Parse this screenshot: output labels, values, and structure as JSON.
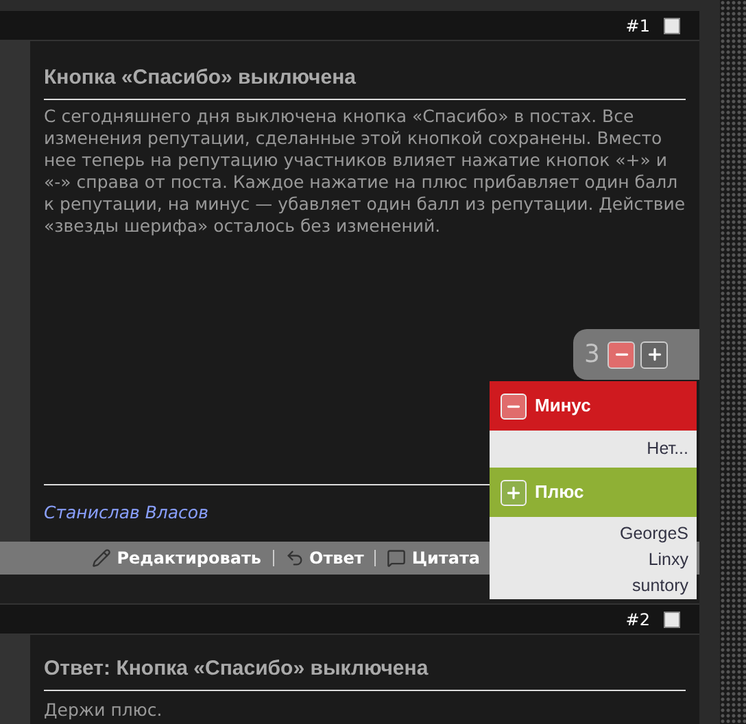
{
  "posts": [
    {
      "number": "#1",
      "selected": false,
      "title": "Кнопка «Спасибо» выключена",
      "body": "С сегодняшнего дня выключена кнопка «Спасибо» в постах. Все изменения репутации, сделанные этой кнопкой сохранены. Вместо нее теперь на репутацию участников влияет нажатие кнопок «+» и «-» справа от поста. Каждое нажатие на плюс прибавляет один балл к репутации, на минус — убавляет один балл из репутации. Действие «звезды шерифа» осталось без изменений.",
      "author": "Станислав Власов",
      "actions": [
        {
          "kind": "edit",
          "label": "Редактировать"
        },
        {
          "kind": "reply",
          "label": "Ответ"
        },
        {
          "kind": "quote",
          "label": "Цитата"
        }
      ]
    },
    {
      "number": "#2",
      "selected": false,
      "title": "Ответ: Кнопка «Спасибо» выключена",
      "body": "Держи плюс."
    }
  ],
  "rating": {
    "score": "3",
    "groups": [
      {
        "kind": "minus",
        "label": "Минус",
        "users": [
          "Нет..."
        ]
      },
      {
        "kind": "plus",
        "label": "Плюс",
        "users": [
          "GeorgeS",
          "Linxy",
          "suntory"
        ]
      }
    ]
  }
}
